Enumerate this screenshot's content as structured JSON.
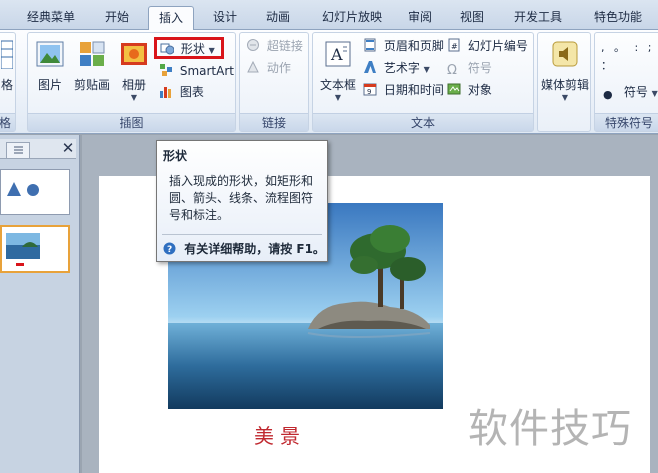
{
  "tabs": [
    "经典菜单",
    "开始",
    "插入",
    "设计",
    "动画",
    "幻灯片放映",
    "审阅",
    "视图",
    "开发工具",
    "特色功能"
  ],
  "active_tab": "插入",
  "ribbon": {
    "left_clip": {
      "label": "格",
      "group": "格"
    },
    "illustrations": {
      "group": "插图",
      "picture": "图片",
      "clipart": "剪贴画",
      "album": "相册",
      "shapes": "形状",
      "smartart": "SmartArt",
      "chart": "图表"
    },
    "links": {
      "group": "链接",
      "hyperlink": "超链接",
      "action": "动作"
    },
    "text": {
      "group": "文本",
      "textbox": "文本框",
      "header_footer": "页眉和页脚",
      "wordart": "艺术字",
      "datetime": "日期和时间",
      "slide_number": "幻灯片编号",
      "symbol": "符号",
      "object": "对象"
    },
    "media": {
      "label": "媒体剪辑"
    },
    "special": {
      "group": "特殊符号",
      "symbol": "符号",
      "marks": ", 。 : ; ："
    }
  },
  "tooltip": {
    "title": "形状",
    "desc": "插入现成的形状，如矩形和圆、箭头、线条、流程图符号和标注。",
    "help": "有关详细帮助，请按 F1。"
  },
  "slide": {
    "caption": "美景"
  },
  "watermark": "软件技巧",
  "colors": {
    "highlight_box": "#d9141a",
    "caption": "#c0282f"
  }
}
